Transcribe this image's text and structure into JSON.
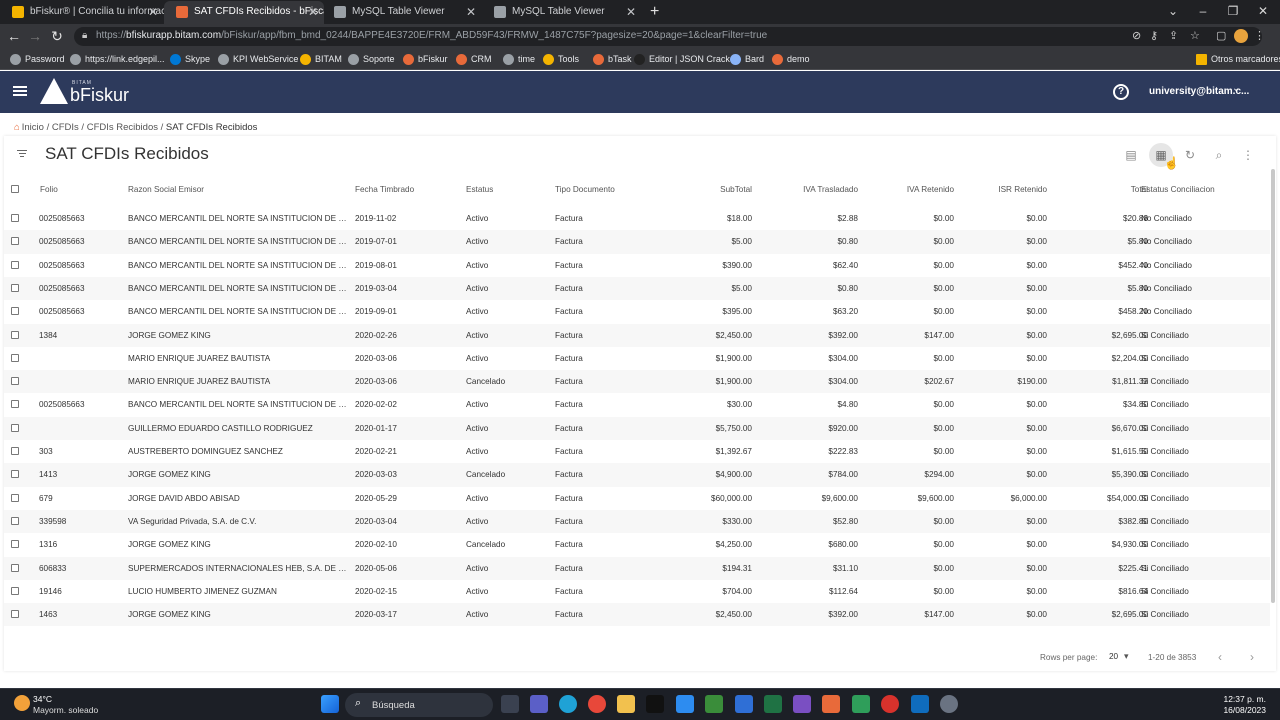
{
  "browser": {
    "tabs": [
      {
        "title": "bFiskur® | Concilia tu información",
        "active": false,
        "color": "#f4b400"
      },
      {
        "title": "SAT CFDIs Recibidos - bFiscal",
        "active": true,
        "color": "#e86a3a"
      },
      {
        "title": "MySQL Table Viewer",
        "active": false,
        "color": "#9aa0a6"
      },
      {
        "title": "MySQL Table Viewer",
        "active": false,
        "color": "#9aa0a6"
      }
    ],
    "url_prefix": "https://",
    "url_host": "bfiskurapp.bitam.com",
    "url_path": "/bFiskur/app/fbm_bmd_0244/BAPPE4E3720E/FRM_ABD59F43/FRMW_1487C75F?pagesize=20&page=1&clearFilter=true",
    "bookmarks": [
      {
        "label": "Password",
        "color": "#9aa0a6"
      },
      {
        "label": "https://link.edgepil...",
        "color": "#9aa0a6"
      },
      {
        "label": "Skype",
        "color": "#0078d4"
      },
      {
        "label": "KPI WebService",
        "color": "#9aa0a6"
      },
      {
        "label": "BITAM",
        "color": "#f4b400"
      },
      {
        "label": "Soporte",
        "color": "#9aa0a6"
      },
      {
        "label": "bFiskur",
        "color": "#e86a3a"
      },
      {
        "label": "CRM",
        "color": "#e86a3a"
      },
      {
        "label": "time",
        "color": "#9aa0a6"
      },
      {
        "label": "Tools",
        "color": "#f4b400"
      },
      {
        "label": "bTask",
        "color": "#e86a3a"
      },
      {
        "label": "Editor | JSON Crack",
        "color": "#222222"
      },
      {
        "label": "Bard",
        "color": "#8ab4f8"
      },
      {
        "label": "demo",
        "color": "#e86a3a"
      }
    ],
    "other_bookmarks": "Otros marcadores"
  },
  "app": {
    "logo_sup": "BITAM",
    "logo": "bFiskur",
    "user": "university@bitam.c...",
    "header_color": "#2d3a5c"
  },
  "breadcrumb": {
    "home": "Inicio",
    "sep": "/",
    "items": [
      "CFDIs",
      "CFDIs Recibidos"
    ],
    "current": "SAT CFDIs Recibidos"
  },
  "page": {
    "title": "SAT CFDIs Recibidos"
  },
  "table": {
    "columns": [
      "Folio",
      "Razon Social Emisor",
      "Fecha Timbrado",
      "Estatus",
      "Tipo Documento",
      "SubTotal",
      "IVA Trasladado",
      "IVA Retenido",
      "ISR Retenido",
      "Total",
      "Estatus Conciliacion"
    ],
    "rows": [
      [
        "0025085663",
        "BANCO MERCANTIL DEL NORTE SA INSTITUCION DE BANCA MULTIPLE",
        "2019-11-02",
        "Activo",
        "Factura",
        "$18.00",
        "$2.88",
        "$0.00",
        "$0.00",
        "$20.88",
        "No Conciliado"
      ],
      [
        "0025085663",
        "BANCO MERCANTIL DEL NORTE SA INSTITUCION DE BANCA MULTIPLE",
        "2019-07-01",
        "Activo",
        "Factura",
        "$5.00",
        "$0.80",
        "$0.00",
        "$0.00",
        "$5.80",
        "No Conciliado"
      ],
      [
        "0025085663",
        "BANCO MERCANTIL DEL NORTE SA INSTITUCION DE BANCA MULTIPLE",
        "2019-08-01",
        "Activo",
        "Factura",
        "$390.00",
        "$62.40",
        "$0.00",
        "$0.00",
        "$452.40",
        "No Conciliado"
      ],
      [
        "0025085663",
        "BANCO MERCANTIL DEL NORTE SA INSTITUCION DE BANCA MULTIPLE",
        "2019-03-04",
        "Activo",
        "Factura",
        "$5.00",
        "$0.80",
        "$0.00",
        "$0.00",
        "$5.80",
        "No Conciliado"
      ],
      [
        "0025085663",
        "BANCO MERCANTIL DEL NORTE SA INSTITUCION DE BANCA MULTIPLE",
        "2019-09-01",
        "Activo",
        "Factura",
        "$395.00",
        "$63.20",
        "$0.00",
        "$0.00",
        "$458.20",
        "No Conciliado"
      ],
      [
        "1384",
        "JORGE GOMEZ KING",
        "2020-02-26",
        "Activo",
        "Factura",
        "$2,450.00",
        "$392.00",
        "$147.00",
        "$0.00",
        "$2,695.00",
        "Si Conciliado"
      ],
      [
        "",
        "MARIO ENRIQUE JUAREZ BAUTISTA",
        "2020-03-06",
        "Activo",
        "Factura",
        "$1,900.00",
        "$304.00",
        "$0.00",
        "$0.00",
        "$2,204.00",
        "Si Conciliado"
      ],
      [
        "",
        "MARIO ENRIQUE JUAREZ BAUTISTA",
        "2020-03-06",
        "Cancelado",
        "Factura",
        "$1,900.00",
        "$304.00",
        "$202.67",
        "$190.00",
        "$1,811.33",
        "Si Conciliado"
      ],
      [
        "0025085663",
        "BANCO MERCANTIL DEL NORTE SA INSTITUCION DE BANCA MULTIPLE",
        "2020-02-02",
        "Activo",
        "Factura",
        "$30.00",
        "$4.80",
        "$0.00",
        "$0.00",
        "$34.80",
        "Si Conciliado"
      ],
      [
        "",
        "GUILLERMO EDUARDO CASTILLO RODRIGUEZ",
        "2020-01-17",
        "Activo",
        "Factura",
        "$5,750.00",
        "$920.00",
        "$0.00",
        "$0.00",
        "$6,670.00",
        "Si Conciliado"
      ],
      [
        "303",
        "AUSTREBERTO DOMINGUEZ SANCHEZ",
        "2020-02-21",
        "Activo",
        "Factura",
        "$1,392.67",
        "$222.83",
        "$0.00",
        "$0.00",
        "$1,615.50",
        "Si Conciliado"
      ],
      [
        "1413",
        "JORGE GOMEZ KING",
        "2020-03-03",
        "Cancelado",
        "Factura",
        "$4,900.00",
        "$784.00",
        "$294.00",
        "$0.00",
        "$5,390.00",
        "Si Conciliado"
      ],
      [
        "679",
        "JORGE DAVID ABDO ABISAD",
        "2020-05-29",
        "Activo",
        "Factura",
        "$60,000.00",
        "$9,600.00",
        "$9,600.00",
        "$6,000.00",
        "$54,000.00",
        "Si Conciliado"
      ],
      [
        "339598",
        "VA Seguridad Privada, S.A. de C.V.",
        "2020-03-04",
        "Activo",
        "Factura",
        "$330.00",
        "$52.80",
        "$0.00",
        "$0.00",
        "$382.80",
        "Si Conciliado"
      ],
      [
        "1316",
        "JORGE GOMEZ KING",
        "2020-02-10",
        "Cancelado",
        "Factura",
        "$4,250.00",
        "$680.00",
        "$0.00",
        "$0.00",
        "$4,930.00",
        "Si Conciliado"
      ],
      [
        "606833",
        "SUPERMERCADOS INTERNACIONALES HEB, S.A. DE C.V.",
        "2020-05-06",
        "Activo",
        "Factura",
        "$194.31",
        "$31.10",
        "$0.00",
        "$0.00",
        "$225.41",
        "Si Conciliado"
      ],
      [
        "19146",
        "LUCIO HUMBERTO JIMENEZ GUZMAN",
        "2020-02-15",
        "Activo",
        "Factura",
        "$704.00",
        "$112.64",
        "$0.00",
        "$0.00",
        "$816.64",
        "Si Conciliado"
      ],
      [
        "1463",
        "JORGE GOMEZ KING",
        "2020-03-17",
        "Activo",
        "Factura",
        "$2,450.00",
        "$392.00",
        "$147.00",
        "$0.00",
        "$2,695.00",
        "Si Conciliado"
      ]
    ]
  },
  "pagination": {
    "rows_per_page_label": "Rows per page:",
    "rows_per_page": "20",
    "range": "1-20 de 3853"
  },
  "taskbar": {
    "temp": "34°C",
    "weather": "Mayorm. soleado",
    "search_placeholder": "Búsqueda",
    "time": "12:37 p. m.",
    "date": "16/08/2023"
  }
}
